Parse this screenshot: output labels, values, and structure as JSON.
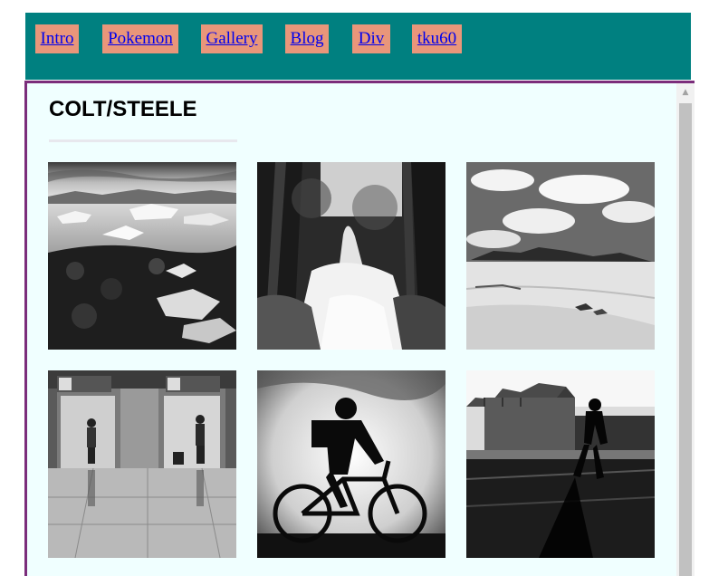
{
  "nav": {
    "links": [
      {
        "label": "Intro"
      },
      {
        "label": "Pokemon"
      },
      {
        "label": "Gallery"
      },
      {
        "label": "Blog"
      },
      {
        "label": "Div"
      },
      {
        "label": "tku60"
      }
    ]
  },
  "site": {
    "title": "COLT/STEELE"
  },
  "colors": {
    "nav_background": "#008080",
    "nav_button": "#e9967a",
    "link": "#0000ee",
    "content_background": "#f0ffff",
    "frame_border": "#7b2d7b"
  },
  "gallery": {
    "photos": [
      {
        "subject": "glacier-lagoon-ice"
      },
      {
        "subject": "forest-waterfall"
      },
      {
        "subject": "desert-dunes-clouds"
      },
      {
        "subject": "airport-elevators-travelers"
      },
      {
        "subject": "cyclist-silhouette"
      },
      {
        "subject": "walker-silhouette-city"
      }
    ]
  },
  "scrollbar": {
    "up_arrow_icon": "triangle-up-icon"
  }
}
